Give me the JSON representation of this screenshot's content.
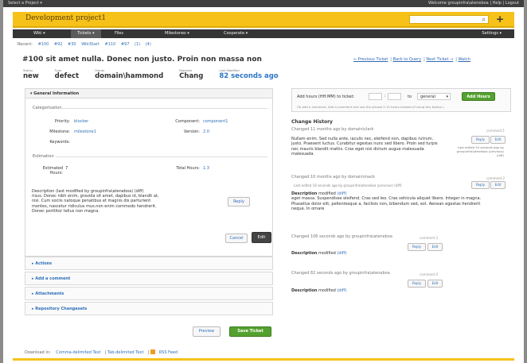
{
  "topbar": {
    "left": "Select a Project ▾",
    "right": "Welcome groupinfra\\ateneboa | Help | Logout"
  },
  "project": {
    "name": "Development project1",
    "search_placeholder": ""
  },
  "nav": {
    "items": [
      "Wiki ▾",
      "Tickets ▾",
      "Files",
      "Milestones ▾",
      "Cooperate ▾"
    ],
    "settings": "Settings ▾"
  },
  "recent": {
    "label": "Recent:",
    "items": [
      "#100",
      "#92",
      "#30",
      "WikiStart",
      "#110",
      "#97",
      "(1)",
      "(4)"
    ]
  },
  "ticket": {
    "title": "#100 sit amet nulla. Donec non justo. Proin non massa non",
    "previous": "← Previous Ticket",
    "back": "Back to Query",
    "next": "Next Ticket →",
    "watch": "Watch"
  },
  "meta": [
    {
      "label": "Status",
      "value": "new"
    },
    {
      "label": "Type",
      "value": "defect"
    },
    {
      "label": "Owner",
      "value": "domain\\hammond"
    },
    {
      "label": "Reporter",
      "value": "Chang"
    },
    {
      "label": "Last Modified",
      "value": "82 seconds ago"
    }
  ],
  "general": {
    "heading": "▾ General Information",
    "categorisation": "Categorisation",
    "priority_label": "Priority:",
    "priority": "blocker",
    "component_label": "Component:",
    "component": "component1",
    "milestone_label": "Milestone:",
    "milestone": "milestone1",
    "version_label": "Version:",
    "version": "2.0",
    "keywords_label": "Keywords:",
    "estimation": "Estimation",
    "estimated_label": "Estimated\nHours:",
    "estimated": "7",
    "total_label": "Total Hours:",
    "total": "1.3",
    "description_label": "Description",
    "description_meta": "(last modified by groupinfra\\ateneboa) (diff)",
    "description": "risus. Donec nibh enim, gravida sit amet, dapibus id, blandit at, nisi. Cum sociis natoque penatibus et magnis dis parturient montes, nascetur ridiculus mus.non enim commodo hendrerit. Donec porttitor tellus non magna.",
    "reply": "Reply",
    "cancel": "Cancel",
    "edit": "Edit"
  },
  "sections": [
    "▸ Actions",
    "▸ Add a comment",
    "▸ Attachments",
    "▸ Repository Changesets"
  ],
  "hours": {
    "label": "Add hours (HH:MM) to ticket:",
    "to": "to",
    "select": "general",
    "button": "Add Hours",
    "hint": "(To add a comment, Add a comment and use the phrase 2:10 hours instead of using this button.)"
  },
  "history": {
    "title": "Change History",
    "entries": [
      {
        "head": "Changed 11 months ago by domain\\clark",
        "id": "comment:1",
        "text": "Nullam enim. Sed nulla ante, iaculis nec, eleifend non, dapibus rutrum, justo. Praesent luctus. Curabitur egestas nunc sed libero. Proin sed turpis nec mauris blandit mattis. Cras eget nisi dictum augue malesuada malesuada.",
        "side": "Last edited 34 seconds ago by groupinfra\\ateneboa (previous) (diff)"
      },
      {
        "head": "Changed 10 months ago by domain\\mack",
        "id": "comment:2",
        "sub": "Last edited 18 seconds ago by groupinfra\\ateneboa (previous) (diff)",
        "description": "Description",
        "modified": "modified",
        "diff": "(diff)",
        "text": "eget massa. Suspendisse eleifend. Cras sed leo. Cras vehicula aliquet libero. Integer in magna. Phasellus dolor elit, pellentesque a, facilisis non, bibendum sed, est. Aenean egestas hendrerit neque. In ornare"
      },
      {
        "head": "Changed 106 seconds ago by groupinfra\\ateneboa",
        "id": "comment:3",
        "description": "Description",
        "modified": "modified",
        "diff": "(diff)"
      },
      {
        "head": "Changed 82 seconds ago by groupinfra\\ateneboa",
        "id": "comment:4",
        "description": "Description",
        "modified": "modified",
        "diff": "(diff)"
      }
    ],
    "reply": "Reply",
    "edit": "Edit"
  },
  "footer": {
    "preview": "Preview",
    "save": "Save Ticket",
    "download": "Download in:",
    "csv": "Comma-delimited Text",
    "tab": "Tab-delimited Text",
    "rss": "RSS Feed"
  }
}
